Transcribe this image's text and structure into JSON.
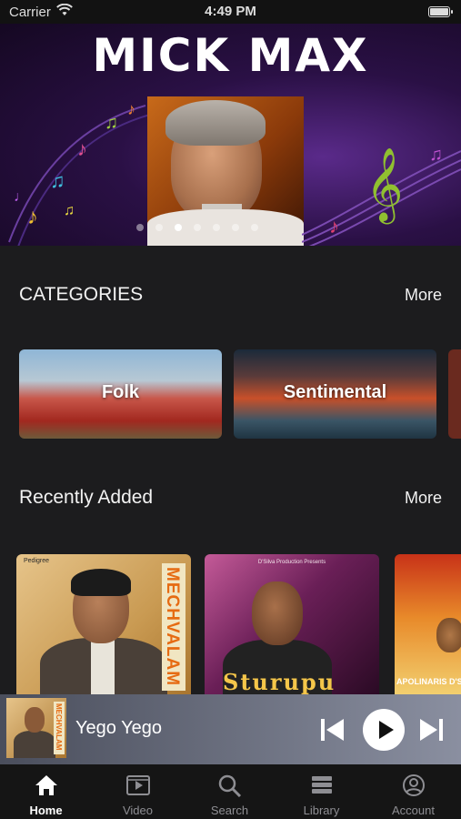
{
  "status_bar": {
    "carrier": "Carrier",
    "time": "4:49 PM"
  },
  "banner": {
    "title": "MICK MAX",
    "carousel_total": 7,
    "carousel_active_index": 2
  },
  "categories": {
    "title": "CATEGORIES",
    "more_label": "More",
    "items": [
      {
        "label": "Folk"
      },
      {
        "label": "Sentimental"
      }
    ]
  },
  "recently_added": {
    "title": "Recently Added",
    "more_label": "More",
    "items": [
      {
        "cover_title": "MECHVALAM",
        "cover_badge": "Pedigree"
      },
      {
        "cover_credit": "D'Silva Production Presents",
        "cover_title": "Sturupu"
      },
      {
        "cover_title": "APOLINARIS D'S"
      }
    ]
  },
  "now_playing": {
    "title": "Yego Yego",
    "art_text": "MECHVALAM"
  },
  "tab_bar": {
    "items": [
      {
        "label": "Home",
        "icon": "home-icon",
        "active": true
      },
      {
        "label": "Video",
        "icon": "video-icon",
        "active": false
      },
      {
        "label": "Search",
        "icon": "search-icon",
        "active": false
      },
      {
        "label": "Library",
        "icon": "library-icon",
        "active": false
      },
      {
        "label": "Account",
        "icon": "account-icon",
        "active": false
      }
    ]
  },
  "colors": {
    "background": "#1c1c1e",
    "tab_active": "#ffffff",
    "tab_inactive": "#8e8e93"
  }
}
